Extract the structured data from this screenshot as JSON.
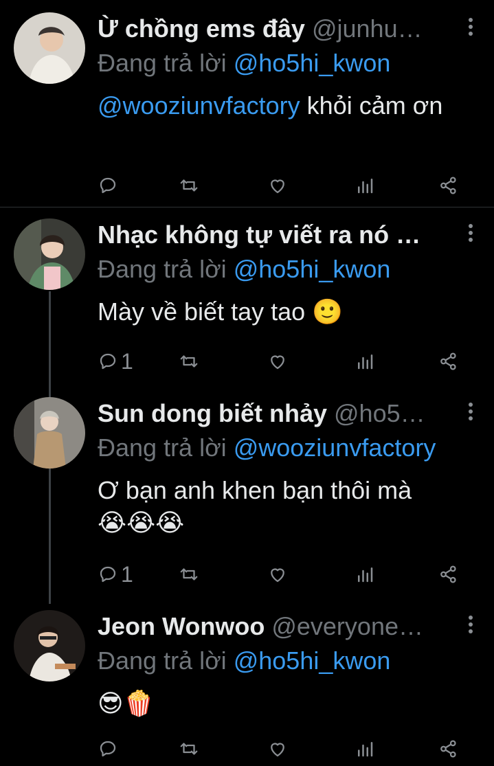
{
  "tweets": [
    {
      "name": "Ừ chồng ems đây",
      "handle": "@junhu…",
      "reply_label": "Đang trả lời",
      "reply_to": "@ho5hi_kwon",
      "mention": "@wooziunvfactory",
      "text": " khỏi cảm ơn",
      "reply_count": ""
    },
    {
      "name": "Nhạc không tự viết ra nó …",
      "handle": "",
      "reply_label": "Đang trả lời",
      "reply_to": "@ho5hi_kwon",
      "text": "Mày về biết tay tao ",
      "emoji": "🙂",
      "reply_count": "1"
    },
    {
      "name": "Sun dong biết nhảy",
      "handle": "@ho5…",
      "reply_label": "Đang trả lời",
      "reply_to": "@wooziunvfactory",
      "text": "Ơ bạn anh khen bạn thôi mà",
      "emoji": "😭😭😭",
      "reply_count": "1"
    },
    {
      "name": "Jeon Wonwoo",
      "handle": "@everyone…",
      "reply_label": "Đang trả lời",
      "reply_to": "@ho5hi_kwon",
      "emoji": "😎🍿",
      "reply_count": ""
    }
  ],
  "icons": [
    "reply-icon",
    "retweet-icon",
    "like-icon",
    "analytics-icon",
    "share-icon",
    "more-icon"
  ],
  "colors": {
    "background": "#000000",
    "text": "#e7e9ea",
    "secondary": "#71767b",
    "link": "#3a9bf0"
  }
}
